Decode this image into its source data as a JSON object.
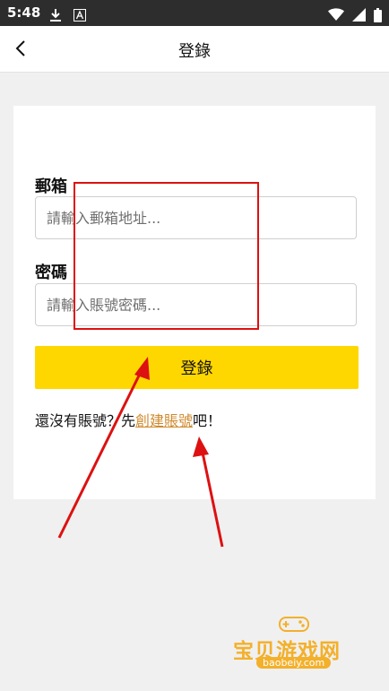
{
  "status_bar": {
    "time": "5:48",
    "icons": [
      "download-icon",
      "font-icon",
      "wifi-icon",
      "signal-icon",
      "battery-icon"
    ]
  },
  "header": {
    "back_icon": "back-arrow-icon",
    "title": "登錄"
  },
  "form": {
    "email_label": "郵箱",
    "email_placeholder": "請輸入郵箱地址...",
    "email_value": "",
    "password_label": "密碼",
    "password_placeholder": "請輸入賬號密碼...",
    "password_value": "",
    "submit_label": "登錄",
    "signup_prefix": "還沒有賬號？先",
    "signup_link": "創建賬號",
    "signup_suffix": "吧！"
  },
  "watermark": {
    "text": "宝贝游戏网",
    "url": "baobeiy.com"
  },
  "colors": {
    "accent_yellow": "#fed700",
    "link_orange": "#cf8a2d",
    "annotation_red": "#dd1111"
  }
}
